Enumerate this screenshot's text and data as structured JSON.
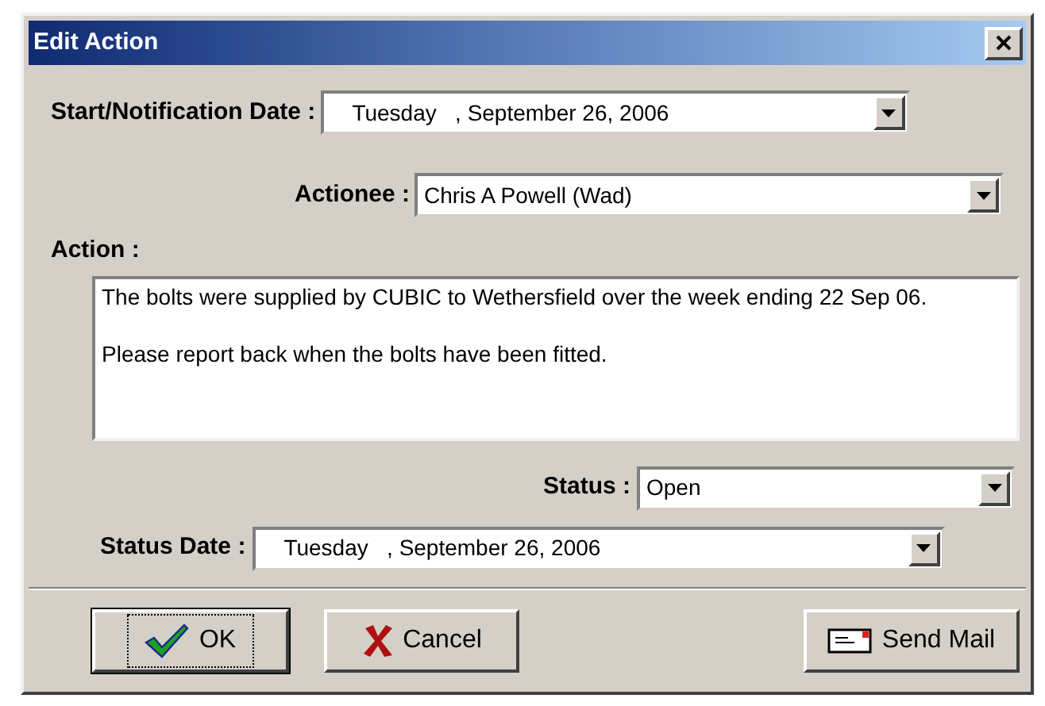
{
  "window": {
    "title": "Edit Action"
  },
  "start_date": {
    "label": "Start/Notification Date :",
    "value": "Tuesday   , September 26, 2006"
  },
  "actionee": {
    "label": "Actionee :",
    "value": "Chris A Powell (Wad)"
  },
  "action": {
    "label": "Action :",
    "value": "The bolts were supplied by CUBIC to Wethersfield over the week ending 22 Sep 06.\n\nPlease report back when the bolts have been fitted."
  },
  "status": {
    "label": "Status :",
    "value": "Open"
  },
  "status_date": {
    "label": "Status Date :",
    "value": "Tuesday   , September 26, 2006"
  },
  "buttons": [
    {
      "kind": "ok",
      "label": "OK",
      "focused": true
    },
    {
      "kind": "cancel",
      "label": "Cancel",
      "focused": false
    },
    {
      "kind": "mail",
      "label": "Send Mail",
      "focused": false
    }
  ]
}
